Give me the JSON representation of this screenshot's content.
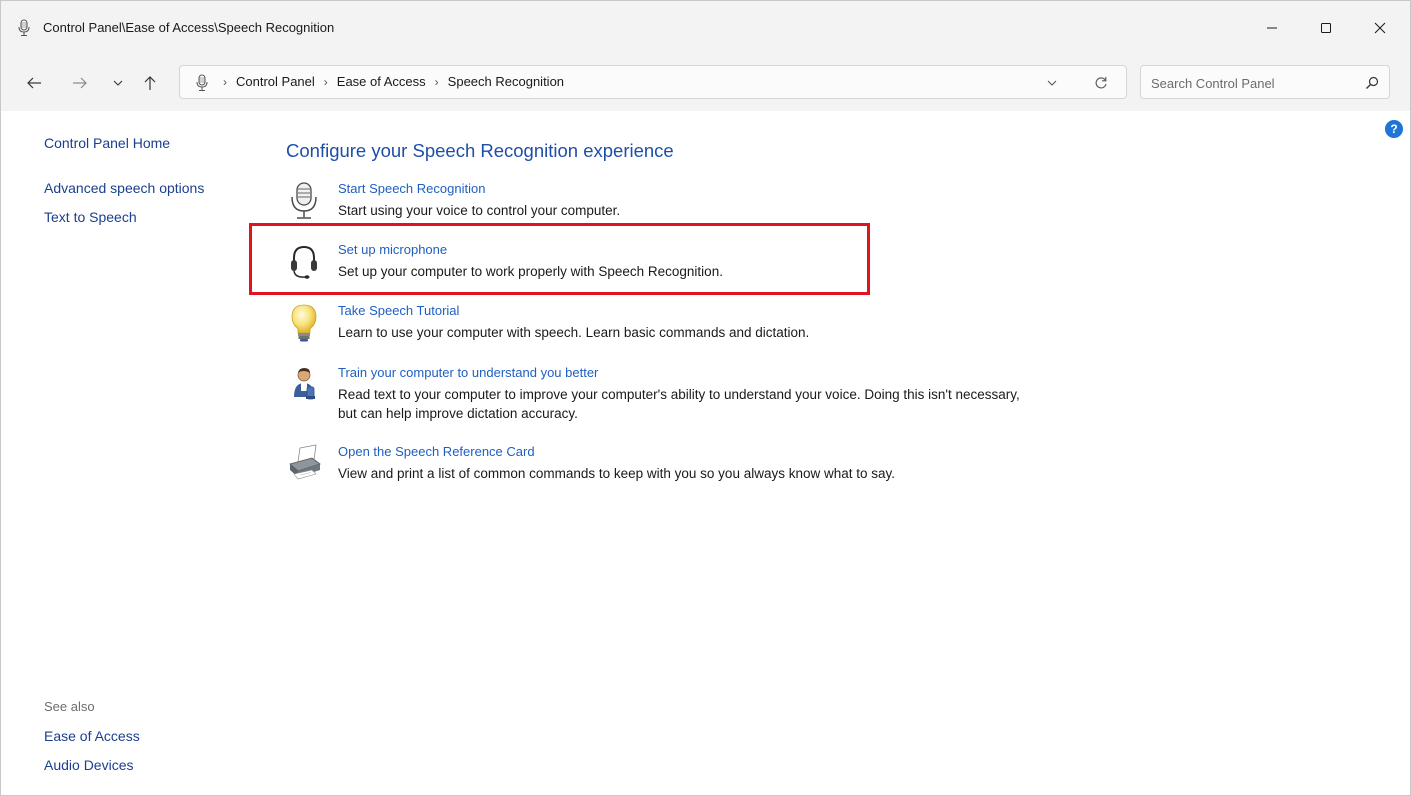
{
  "window": {
    "title": "Control Panel\\Ease of Access\\Speech Recognition"
  },
  "address": {
    "crumbs": [
      "Control Panel",
      "Ease of Access",
      "Speech Recognition"
    ],
    "separator": "›"
  },
  "search": {
    "placeholder": "Search Control Panel"
  },
  "sidebar": {
    "home": "Control Panel Home",
    "links": [
      "Advanced speech options",
      "Text to Speech"
    ],
    "see_also_label": "See also",
    "see_also_links": [
      "Ease of Access",
      "Audio Devices"
    ]
  },
  "main": {
    "heading": "Configure your Speech Recognition experience",
    "tasks": [
      {
        "icon": "microphone-icon",
        "link": "Start Speech Recognition",
        "desc": "Start using your voice to control your computer."
      },
      {
        "icon": "headset-icon",
        "link": "Set up microphone",
        "desc": "Set up your computer to work properly with Speech Recognition."
      },
      {
        "icon": "lightbulb-icon",
        "link": "Take Speech Tutorial",
        "desc": "Learn to use your computer with speech. Learn basic commands and dictation."
      },
      {
        "icon": "user-training-icon",
        "link": "Train your computer to understand you better",
        "desc": "Read text to your computer to improve your computer's ability to understand your voice. Doing this isn't necessary, but can help improve dictation accuracy."
      },
      {
        "icon": "printer-icon",
        "link": "Open the Speech Reference Card",
        "desc": "View and print a list of common commands to keep with you so you always know what to say."
      }
    ]
  },
  "help": {
    "label": "?"
  },
  "colors": {
    "link": "#1f5fc2",
    "heading": "#1e4fa8",
    "highlight": "#e0141e"
  }
}
